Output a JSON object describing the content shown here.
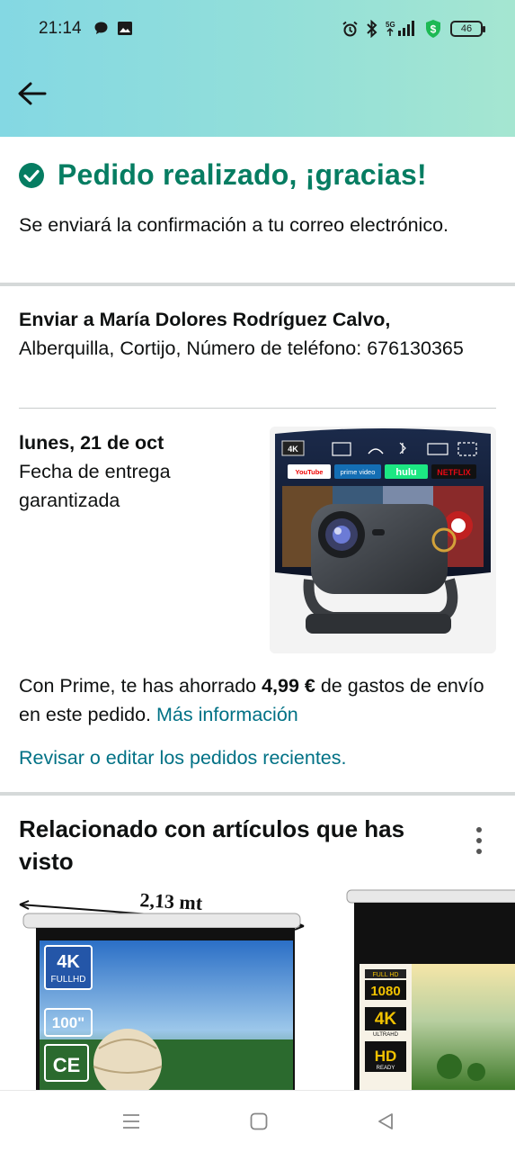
{
  "status_bar": {
    "time": "21:14",
    "battery": "46",
    "network": "5G",
    "icons": [
      "chat-bubble-icon",
      "image-icon",
      "alarm-icon",
      "bluetooth-icon",
      "signal-icon",
      "shield-dollar-icon",
      "battery-icon"
    ]
  },
  "header": {
    "back_icon": "back-arrow-icon"
  },
  "confirmation": {
    "title": "Pedido realizado, ¡gracias!",
    "subtitle": "Se enviará la confirmación a tu correo electrónico."
  },
  "shipping": {
    "to_label": "Enviar a María Dolores Rodríguez Calvo,",
    "address": "Alberquilla, Cortijo, Número de teléfono: 676130365"
  },
  "delivery": {
    "date": "lunes, 21 de oct",
    "note": "Fecha de entrega garantizada"
  },
  "product_image": {
    "badges": [
      "4K",
      "YouTube",
      "prime video",
      "hulu",
      "NETFLIX"
    ]
  },
  "prime": {
    "text_before": "Con Prime, te has ahorrado ",
    "amount": "4,99 €",
    "text_after": " de gastos de envío en este pedido. ",
    "more_link": "Más información"
  },
  "review_link": "Revisar o editar los pedidos recientes.",
  "related": {
    "title": "Relacionado con artículos que has visto",
    "items": [
      {
        "dimension_label": "2,13 mt",
        "badges": [
          "4K",
          "FULLHD",
          "100\"",
          "CE"
        ]
      },
      {
        "badges": [
          "FULL HD",
          "1080",
          "4K",
          "ULTRAHD",
          "HD",
          "READY"
        ]
      }
    ]
  },
  "nav_bar": {
    "buttons": [
      "menu-icon",
      "home-icon",
      "back-triangle-icon"
    ]
  }
}
